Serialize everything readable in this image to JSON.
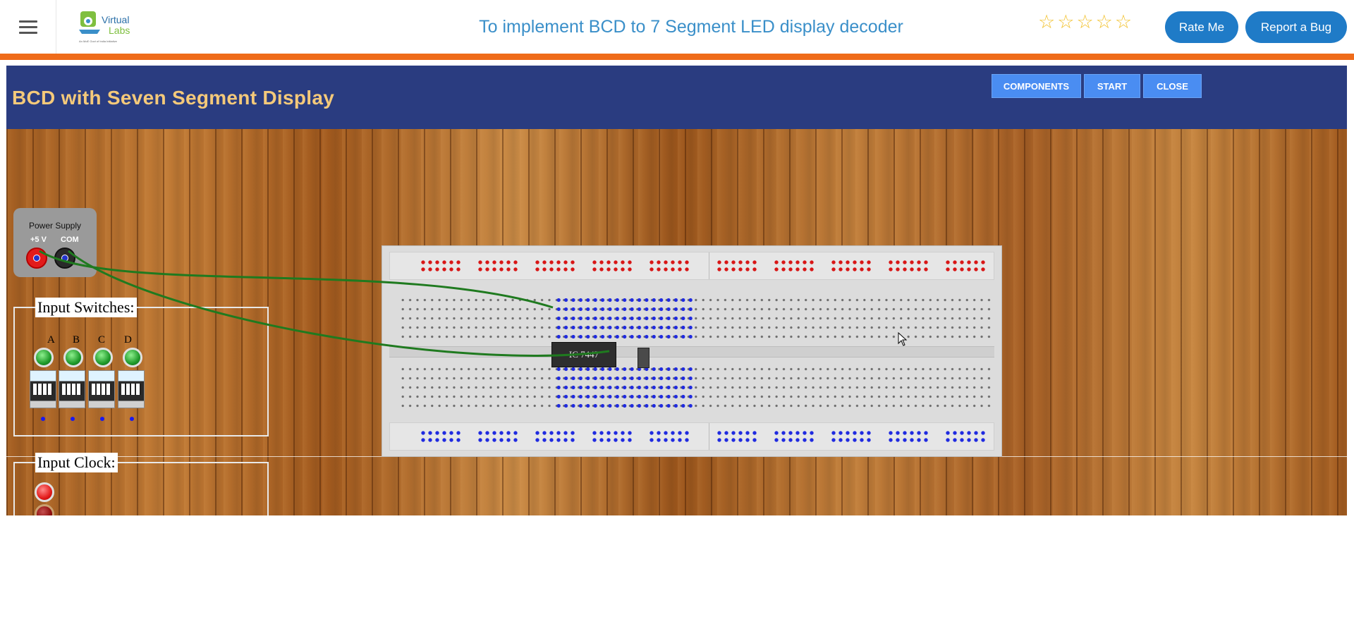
{
  "header": {
    "title": "To implement BCD to 7 Segment LED display decoder",
    "logo": {
      "line1": "Virtual",
      "line2": "Labs",
      "tagline": "An MoE Govt of India Initiative"
    },
    "rating_stars": 5,
    "rate_label": "Rate Me",
    "bug_label": "Report a Bug",
    "accent_color": "#ef6b1a"
  },
  "sim": {
    "title": "BCD with Seven Segment Display",
    "buttons": {
      "components": "COMPONENTS",
      "start": "START",
      "close": "CLOSE"
    },
    "power": {
      "label": "Power Supply",
      "positive": "+5 V",
      "common": "COM"
    },
    "switches": {
      "legend": "Input Switches:",
      "letters": [
        "A",
        "B",
        "C",
        "D"
      ]
    },
    "clock": {
      "legend": "Input Clock:"
    },
    "breadboard": {
      "ic_label": "IC 7447"
    }
  }
}
